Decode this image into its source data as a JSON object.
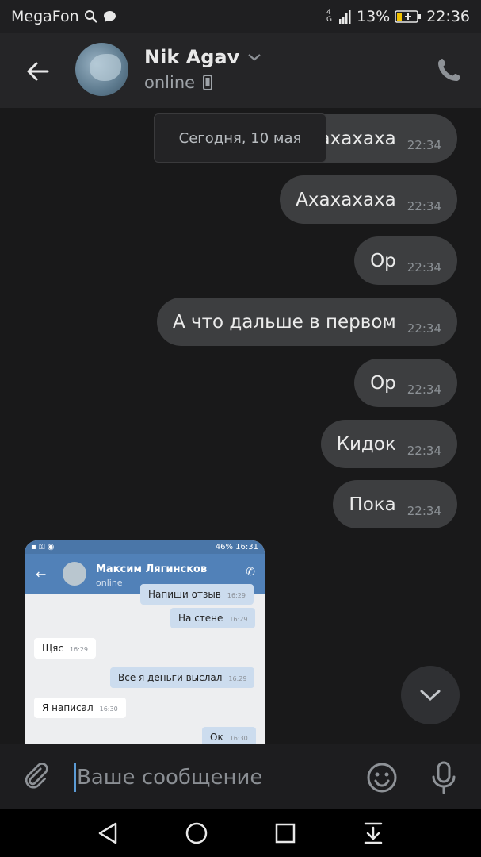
{
  "status_bar": {
    "carrier": "MegaFon",
    "network": "4G",
    "battery": "13%",
    "time": "22:36"
  },
  "header": {
    "contact_name": "Nik Agav",
    "contact_status": "online"
  },
  "date_separator": "Сегодня, 10 мая",
  "messages": [
    {
      "text": "Ахахахаха",
      "time": "22:34",
      "visible_text": "хахаха"
    },
    {
      "text": "Ахахахаха",
      "time": "22:34"
    },
    {
      "text": "Ор",
      "time": "22:34"
    },
    {
      "text": "А что дальше в первом",
      "time": "22:34"
    },
    {
      "text": "Ор",
      "time": "22:34"
    },
    {
      "text": "Кидок",
      "time": "22:34"
    },
    {
      "text": "Пока",
      "time": "22:34"
    }
  ],
  "photo_attachment": {
    "status_time": "16:31",
    "status_battery": "46%",
    "contact_name": "Максим Лягинсков",
    "contact_status": "online",
    "messages": [
      {
        "text": "Напиши отзыв",
        "time": "16:29",
        "out": true
      },
      {
        "text": "На стене",
        "time": "16:29",
        "out": true
      },
      {
        "text": "Щяс",
        "time": "16:29",
        "out": false
      },
      {
        "text": "Все я деньги выслал",
        "time": "16:29",
        "out": true
      },
      {
        "text": "Я написал",
        "time": "16:30",
        "out": false
      },
      {
        "text": "Ок",
        "time": "16:30",
        "out": true
      }
    ]
  },
  "composer": {
    "placeholder": "Ваше сообщение"
  },
  "colors": {
    "background": "#19191a",
    "bubble": "#3d3e40",
    "header": "#252527",
    "accent": "#5181b8"
  },
  "icons": {
    "back": "arrow-left-icon",
    "phone": "phone-icon",
    "attach": "paperclip-icon",
    "emoji": "smile-icon",
    "mic": "microphone-icon",
    "scroll": "chevron-down-icon"
  }
}
